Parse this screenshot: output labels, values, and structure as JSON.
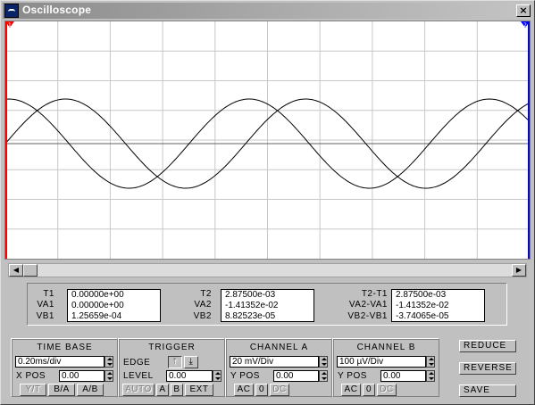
{
  "window": {
    "title": "Oscilloscope",
    "close_glyph": "×",
    "icon": "oscilloscope-app-icon"
  },
  "screen": {
    "markers": {
      "left": "1",
      "right": "2"
    },
    "colors": {
      "background": "#ffffff",
      "grid": "#c8c8c8",
      "trace": "#000000",
      "cursor_left": "#ff0000",
      "cursor_right": "#0000ff"
    }
  },
  "scrollbar": {
    "left_glyph": "◀",
    "right_glyph": "▶"
  },
  "measurements": {
    "t1_label": "T1",
    "t1": "0.00000e+00",
    "va1_label": "VA1",
    "va1": "0.00000e+00",
    "vb1_label": "VB1",
    "vb1": "1.25659e-04",
    "t2_label": "T2",
    "t2": "2.87500e-03",
    "va2_label": "VA2",
    "va2": "-1.41352e-02",
    "vb2_label": "VB2",
    "vb2": "8.82523e-05",
    "dt_label": "T2-T1",
    "dt": "2.87500e-03",
    "dva_label": "VA2-VA1",
    "dva": "-1.41352e-02",
    "dvb_label": "VB2-VB1",
    "dvb": "-3.74065e-05"
  },
  "time_base": {
    "title": "TIME BASE",
    "value": "0.20ms/div",
    "xpos_label": "X POS",
    "xpos": "0.00",
    "modes": [
      "Y/T",
      "B/A",
      "A/B"
    ]
  },
  "trigger": {
    "title": "TRIGGER",
    "edge_label": "EDGE",
    "level_label": "LEVEL",
    "level": "0.00",
    "edge_rise_glyph": "⤒",
    "edge_fall_glyph": "⤓",
    "sources": [
      "AUTO",
      "A",
      "B",
      "EXT"
    ]
  },
  "channel_a": {
    "title": "CHANNEL A",
    "value": "20 mV/Div",
    "ypos_label": "Y POS",
    "ypos": "0.00",
    "coupling": [
      "AC",
      "0",
      "DC"
    ]
  },
  "channel_b": {
    "title": "CHANNEL B",
    "value": "100 µV/Div",
    "ypos_label": "Y POS",
    "ypos": "0.00",
    "coupling": [
      "AC",
      "0",
      "DC"
    ]
  },
  "actions": {
    "reduce": "REDUCE",
    "reverse": "REVERSE",
    "save": "SAVE"
  }
}
